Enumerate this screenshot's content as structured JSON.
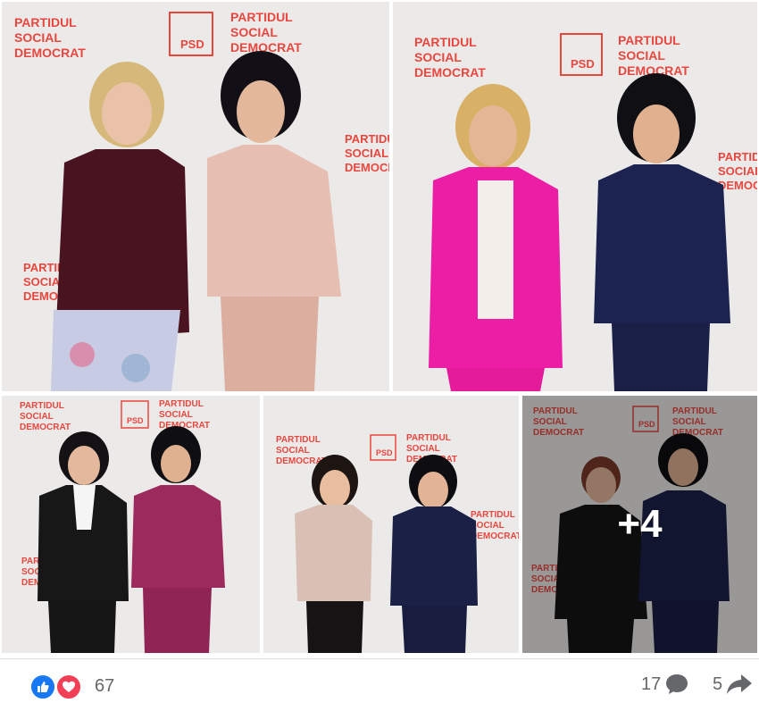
{
  "brand": {
    "logo_text": "PSD",
    "wordmark_lines": [
      "PARTIDUL",
      "SOCIAL",
      "DEMOCRAT"
    ],
    "brand_color": "#e8473f",
    "backdrop_color": "#ecebe9"
  },
  "gallery": {
    "photos": [
      {
        "id": 1,
        "people": [
          {
            "outfit": "burgundy velvet jacket, floral skirt",
            "hair": "blonde"
          },
          {
            "outfit": "blush pink suit with belt",
            "hair": "black"
          }
        ]
      },
      {
        "id": 2,
        "people": [
          {
            "outfit": "hot pink suit",
            "hair": "blonde"
          },
          {
            "outfit": "navy suit",
            "hair": "black"
          }
        ]
      },
      {
        "id": 3,
        "people": [
          {
            "outfit": "black suit",
            "hair": "black"
          },
          {
            "outfit": "magenta suit",
            "hair": "black"
          }
        ]
      },
      {
        "id": 4,
        "people": [
          {
            "outfit": "beige blouse",
            "hair": "dark"
          },
          {
            "outfit": "navy suit",
            "hair": "black"
          }
        ]
      },
      {
        "id": 5,
        "people": [
          {
            "outfit": "black suit",
            "hair": "reddish"
          },
          {
            "outfit": "navy suit",
            "hair": "black"
          }
        ]
      }
    ],
    "more_label": "+4"
  },
  "footer": {
    "reactions": [
      {
        "icon": "like-reaction-icon",
        "color": "#1877f2"
      },
      {
        "icon": "love-reaction-icon",
        "color": "#f33e58"
      }
    ],
    "reaction_count": "67",
    "comment_count": "17",
    "share_count": "5"
  }
}
